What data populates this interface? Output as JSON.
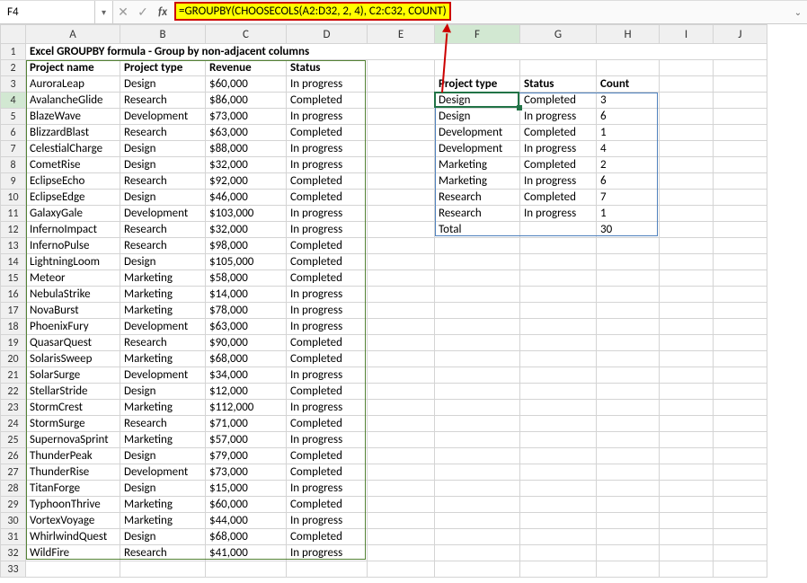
{
  "name_box": "F4",
  "formula": "=GROUPBY(CHOOSECOLS(A2:D32, 2, 4), C2:C32, COUNT)",
  "title": "Excel GROUPBY formula - Group by non-adjacent columns",
  "col_letters": [
    "A",
    "B",
    "C",
    "D",
    "E",
    "F",
    "G",
    "H",
    "I",
    "J"
  ],
  "src_headers": {
    "a": "Project name",
    "b": "Project type",
    "c": "Revenue",
    "d": "Status"
  },
  "out_headers": {
    "f": "Project type",
    "g": "Status",
    "h": "Count"
  },
  "rows": [
    {
      "name": "AuroraLeap",
      "type": "Design",
      "rev": "$60,000",
      "status": "In progress"
    },
    {
      "name": "AvalancheGlide",
      "type": "Research",
      "rev": "$86,000",
      "status": "Completed"
    },
    {
      "name": "BlazeWave",
      "type": "Development",
      "rev": "$73,000",
      "status": "In progress"
    },
    {
      "name": "BlizzardBlast",
      "type": "Research",
      "rev": "$63,000",
      "status": "Completed"
    },
    {
      "name": "CelestialCharge",
      "type": "Design",
      "rev": "$88,000",
      "status": "In progress"
    },
    {
      "name": "CometRise",
      "type": "Design",
      "rev": "$32,000",
      "status": "In progress"
    },
    {
      "name": "EclipseEcho",
      "type": "Research",
      "rev": "$92,000",
      "status": "Completed"
    },
    {
      "name": "EclipseEdge",
      "type": "Design",
      "rev": "$46,000",
      "status": "Completed"
    },
    {
      "name": "GalaxyGale",
      "type": "Development",
      "rev": "$103,000",
      "status": "In progress"
    },
    {
      "name": "InfernoImpact",
      "type": "Research",
      "rev": "$32,000",
      "status": "In progress"
    },
    {
      "name": "InfernoPulse",
      "type": "Research",
      "rev": "$98,000",
      "status": "Completed"
    },
    {
      "name": "LightningLoom",
      "type": "Design",
      "rev": "$105,000",
      "status": "Completed"
    },
    {
      "name": "Meteor",
      "type": "Marketing",
      "rev": "$58,000",
      "status": "Completed"
    },
    {
      "name": "NebulaStrike",
      "type": "Marketing",
      "rev": "$14,000",
      "status": "In progress"
    },
    {
      "name": "NovaBurst",
      "type": "Marketing",
      "rev": "$78,000",
      "status": "In progress"
    },
    {
      "name": "PhoenixFury",
      "type": "Development",
      "rev": "$63,000",
      "status": "In progress"
    },
    {
      "name": "QuasarQuest",
      "type": "Research",
      "rev": "$90,000",
      "status": "Completed"
    },
    {
      "name": "SolarisSweep",
      "type": "Marketing",
      "rev": "$68,000",
      "status": "Completed"
    },
    {
      "name": "SolarSurge",
      "type": "Development",
      "rev": "$34,000",
      "status": "In progress"
    },
    {
      "name": "StellarStride",
      "type": "Design",
      "rev": "$12,000",
      "status": "Completed"
    },
    {
      "name": "StormCrest",
      "type": "Marketing",
      "rev": "$112,000",
      "status": "In progress"
    },
    {
      "name": "StormSurge",
      "type": "Research",
      "rev": "$71,000",
      "status": "Completed"
    },
    {
      "name": "SupernovaSprint",
      "type": "Marketing",
      "rev": "$57,000",
      "status": "In progress"
    },
    {
      "name": "ThunderPeak",
      "type": "Design",
      "rev": "$79,000",
      "status": "Completed"
    },
    {
      "name": "ThunderRise",
      "type": "Development",
      "rev": "$73,000",
      "status": "Completed"
    },
    {
      "name": "TitanForge",
      "type": "Design",
      "rev": "$15,000",
      "status": "In progress"
    },
    {
      "name": "TyphoonThrive",
      "type": "Marketing",
      "rev": "$60,000",
      "status": "Completed"
    },
    {
      "name": "VortexVoyage",
      "type": "Marketing",
      "rev": "$44,000",
      "status": "In progress"
    },
    {
      "name": "WhirlwindQuest",
      "type": "Design",
      "rev": "$68,000",
      "status": "Completed"
    },
    {
      "name": "WildFire",
      "type": "Research",
      "rev": "$41,000",
      "status": "In progress"
    }
  ],
  "output": [
    {
      "type": "Design",
      "status": "Completed",
      "count": "3"
    },
    {
      "type": "Design",
      "status": "In progress",
      "count": "6"
    },
    {
      "type": "Development",
      "status": "Completed",
      "count": "1"
    },
    {
      "type": "Development",
      "status": "In progress",
      "count": "4"
    },
    {
      "type": "Marketing",
      "status": "Completed",
      "count": "2"
    },
    {
      "type": "Marketing",
      "status": "In progress",
      "count": "6"
    },
    {
      "type": "Research",
      "status": "Completed",
      "count": "7"
    },
    {
      "type": "Research",
      "status": "In progress",
      "count": "1"
    }
  ],
  "total": {
    "label": "Total",
    "count": "30"
  },
  "chart_data": {
    "type": "table",
    "title": "Excel GROUPBY formula - Group by non-adjacent columns",
    "columns": [
      "Project type",
      "Status",
      "Count"
    ],
    "rows": [
      [
        "Design",
        "Completed",
        3
      ],
      [
        "Design",
        "In progress",
        6
      ],
      [
        "Development",
        "Completed",
        1
      ],
      [
        "Development",
        "In progress",
        4
      ],
      [
        "Marketing",
        "Completed",
        2
      ],
      [
        "Marketing",
        "In progress",
        6
      ],
      [
        "Research",
        "Completed",
        7
      ],
      [
        "Research",
        "In progress",
        1
      ],
      [
        "Total",
        "",
        30
      ]
    ]
  }
}
